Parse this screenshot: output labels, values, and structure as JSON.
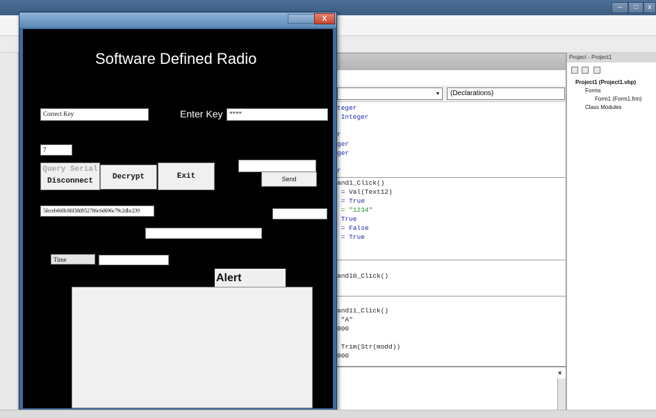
{
  "ide": {
    "project_panel": {
      "title": "Project - Project1",
      "tree": [
        {
          "label": "Project1 (Project1.vbp)"
        },
        {
          "label": "Forms"
        },
        {
          "label": "Form1 (Form1.frm)"
        },
        {
          "label": "Class Modules"
        }
      ]
    },
    "code_window": {
      "declarations_combo": "(Declarations)",
      "code_lines": [
        {
          "text": "teger",
          "kind": "kw"
        },
        {
          "text": " Integer",
          "kind": "kw"
        },
        {
          "text": "r",
          "kind": "kw"
        },
        {
          "text": "ger",
          "kind": "kw"
        },
        {
          "text": "ger",
          "kind": "kw"
        },
        {
          "text": "r",
          "kind": "kw"
        },
        {
          "text": "and1_Click()",
          "kind": "plain"
        },
        {
          "text": " = Val(Text12)",
          "kind": "plain"
        },
        {
          "text": " = True",
          "kind": "kw"
        },
        {
          "text": " = \"1234\"",
          "kind": "str"
        },
        {
          "text": " True",
          "kind": "kw"
        },
        {
          "text": " = False",
          "kind": "kw"
        },
        {
          "text": " = True",
          "kind": "kw"
        },
        {
          "text": "and10_Click()",
          "kind": "plain"
        },
        {
          "text": "and11_Click()",
          "kind": "plain"
        },
        {
          "text": " \"A\"",
          "kind": "plain"
        },
        {
          "text": "000",
          "kind": "plain"
        },
        {
          "text": " Trim(Str(modd))",
          "kind": "plain"
        },
        {
          "text": "000",
          "kind": "plain"
        }
      ]
    }
  },
  "form": {
    "title": "Software Defined Radio",
    "correct_key_box": "Correct Key",
    "enter_key_label": "Enter Key",
    "enter_key_value": "****",
    "small_value_box": "7",
    "query_serial_button": "Query Serial",
    "disconnect_button": "Disconnect",
    "decrypt_button": "Decrypt",
    "exit_button": "Exit",
    "send_button": "Send",
    "hash_box": "5feceb66ffc86f38d952786c6d696c79c2dbc239",
    "time_label": "Time",
    "alert_label": "Alert"
  }
}
